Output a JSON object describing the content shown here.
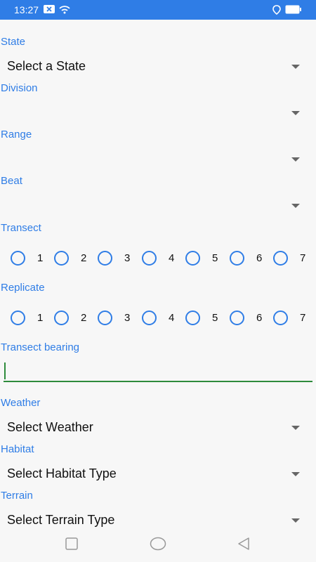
{
  "status_bar": {
    "time": "13:27"
  },
  "form": {
    "state": {
      "label": "State",
      "value": "Select a State"
    },
    "division": {
      "label": "Division",
      "value": ""
    },
    "range": {
      "label": "Range",
      "value": ""
    },
    "beat": {
      "label": "Beat",
      "value": ""
    },
    "transect": {
      "label": "Transect",
      "options": [
        "1",
        "2",
        "3",
        "4",
        "5",
        "6",
        "7"
      ]
    },
    "replicate": {
      "label": "Replicate",
      "options": [
        "1",
        "2",
        "3",
        "4",
        "5",
        "6",
        "7"
      ]
    },
    "transect_bearing": {
      "label": "Transect bearing",
      "value": ""
    },
    "weather": {
      "label": "Weather",
      "value": "Select Weather"
    },
    "habitat": {
      "label": "Habitat",
      "value": "Select Habitat Type"
    },
    "terrain": {
      "label": "Terrain",
      "value": "Select Terrain Type"
    }
  },
  "colors": {
    "accent": "#2f7de6",
    "input_focus": "#2e8b3c"
  },
  "nav_bar": {
    "icons": [
      "recent-apps-icon",
      "home-icon",
      "back-icon"
    ]
  }
}
